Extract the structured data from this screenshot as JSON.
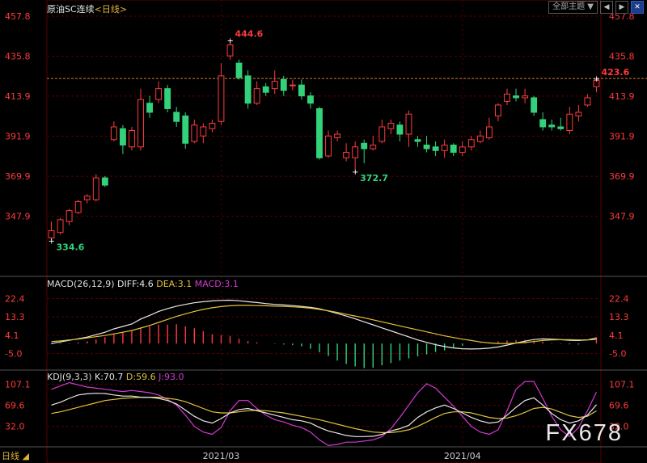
{
  "header": {
    "title": "原油SC连续",
    "period_label": "<日线>",
    "theme_select": "全部主题",
    "theme_arrow": "▼"
  },
  "toolbar": {
    "left_label": "◀",
    "right_label": "▶",
    "close_label": "✕"
  },
  "macd_header": {
    "params": "MACD(26,12,9)",
    "diff": "DIFF:4.6",
    "dea": "DEA:3.1",
    "macd": "MACD:3.1"
  },
  "kdj_header": {
    "params": "KDJ(9,3,3)",
    "k": "K:70.7",
    "d": "D:59.6",
    "j": "J:93.0"
  },
  "footer": {
    "period_button": "日线",
    "period_arrow": "◢"
  },
  "watermark": "FX678",
  "colors": {
    "up": "#ff3b3b",
    "down": "#33d27a",
    "grid": "#5a0000",
    "diff": "#e8e8e8",
    "dea": "#e0c33a",
    "j_line": "#d23ad2",
    "last_price_line": "#d27a3a"
  },
  "chart_data": [
    {
      "type": "candlestick",
      "title": "原油SC连续",
      "y_ticks": [
        "457.8",
        "435.8",
        "413.9",
        "391.9",
        "369.9",
        "347.9"
      ],
      "ylim": [
        326.0,
        457.8
      ],
      "x_ticks": [
        "2021/03",
        "2021/04"
      ],
      "last_price": 423.6,
      "annotations": [
        {
          "label": "444.6",
          "kind": "high"
        },
        {
          "label": "372.7",
          "kind": "low"
        },
        {
          "label": "334.6",
          "kind": "low"
        },
        {
          "label": "423.6",
          "kind": "last"
        }
      ],
      "candles": [
        [
          336,
          340,
          345,
          334.6
        ],
        [
          339,
          346,
          347,
          338
        ],
        [
          345,
          351,
          352,
          343
        ],
        [
          350,
          356,
          357,
          349
        ],
        [
          357,
          359,
          360,
          355
        ],
        [
          357,
          369,
          371,
          356
        ],
        [
          369,
          365,
          370,
          364
        ],
        [
          390,
          397,
          400,
          389
        ],
        [
          396,
          387,
          398,
          382
        ],
        [
          386,
          395,
          397,
          384
        ],
        [
          386,
          412,
          418,
          384
        ],
        [
          410,
          405,
          414,
          402
        ],
        [
          412,
          418,
          422,
          410
        ],
        [
          418,
          407,
          420,
          405
        ],
        [
          405,
          400,
          408,
          397
        ],
        [
          403,
          388,
          405,
          385
        ],
        [
          389,
          398,
          401,
          388
        ],
        [
          392,
          397,
          399,
          388
        ],
        [
          396,
          399,
          401,
          394
        ],
        [
          400,
          425,
          432,
          398
        ],
        [
          436,
          442,
          444.6,
          434
        ],
        [
          432,
          424,
          434,
          423
        ],
        [
          425,
          410,
          428,
          407
        ],
        [
          410,
          418,
          422,
          409
        ],
        [
          419,
          416,
          421,
          414
        ],
        [
          418,
          422,
          428,
          415
        ],
        [
          423,
          417,
          425,
          414
        ],
        [
          420,
          420,
          423,
          417
        ],
        [
          420,
          414,
          423,
          412
        ],
        [
          414,
          410,
          416,
          407
        ],
        [
          407,
          380,
          408,
          379
        ],
        [
          381,
          392,
          395,
          380
        ],
        [
          391,
          393,
          395,
          389
        ],
        [
          380,
          383,
          388,
          378
        ],
        [
          380,
          386,
          389,
          373
        ],
        [
          388,
          385,
          390,
          377
        ],
        [
          385,
          387,
          392,
          384
        ],
        [
          389,
          397,
          401,
          388
        ],
        [
          396,
          399,
          401,
          393
        ],
        [
          398,
          393,
          400,
          389
        ],
        [
          393,
          404,
          406,
          386
        ],
        [
          390,
          389,
          392,
          386
        ],
        [
          387,
          385,
          392,
          383
        ],
        [
          386,
          384,
          389,
          381
        ],
        [
          384,
          387,
          390,
          380
        ],
        [
          387,
          383,
          388,
          381
        ],
        [
          383,
          386,
          389,
          381
        ],
        [
          386,
          390,
          392,
          384
        ],
        [
          389,
          392,
          395,
          388
        ],
        [
          391,
          397,
          402,
          390
        ],
        [
          403,
          409,
          410,
          400
        ],
        [
          411,
          415,
          418,
          409
        ],
        [
          414,
          413,
          418,
          411
        ],
        [
          413,
          414,
          418,
          410
        ],
        [
          413,
          405,
          414,
          403
        ],
        [
          401,
          397,
          405,
          395
        ],
        [
          398,
          397,
          401,
          395
        ],
        [
          397,
          396,
          402,
          395
        ],
        [
          395,
          404,
          408,
          393
        ],
        [
          403,
          405,
          409,
          400
        ],
        [
          409,
          413,
          415,
          408
        ],
        [
          419,
          422.5,
          425,
          416
        ]
      ]
    },
    {
      "type": "macd",
      "params": "MACD(26,12,9)",
      "y_ticks": [
        "22.4",
        "13.3",
        "4.1",
        "-5.0"
      ],
      "ylim": [
        -10.0,
        25.0
      ],
      "diff": [
        0,
        0.8,
        1.6,
        2.4,
        3.2,
        4.4,
        5.6,
        7.3,
        8.5,
        9.7,
        12.2,
        14.0,
        16.0,
        17.4,
        18.6,
        19.5,
        20.3,
        20.8,
        21.2,
        21.5,
        21.6,
        21.3,
        20.8,
        20.4,
        19.9,
        19.5,
        19.2,
        18.9,
        18.5,
        18.0,
        17.3,
        16.2,
        15.0,
        13.7,
        12.3,
        10.8,
        9.3,
        7.8,
        6.3,
        4.8,
        3.3,
        1.8,
        0.6,
        -0.6,
        -1.5,
        -2.2,
        -2.6,
        -2.7,
        -2.6,
        -2.3,
        -1.7,
        -0.8,
        0.2,
        1.2,
        2.0,
        2.3,
        2.2,
        1.9,
        1.6,
        1.5,
        1.8,
        2.8
      ],
      "dea": [
        1.0,
        1.3,
        1.8,
        2.2,
        2.8,
        3.4,
        4.0,
        4.8,
        5.6,
        6.5,
        7.7,
        9.0,
        10.5,
        12.0,
        13.5,
        14.8,
        16.0,
        17.0,
        17.8,
        18.4,
        18.8,
        19.0,
        19.0,
        18.9,
        18.8,
        18.6,
        18.5,
        18.3,
        18.0,
        17.6,
        17.0,
        16.3,
        15.5,
        14.6,
        13.7,
        12.8,
        11.8,
        10.8,
        9.8,
        8.8,
        7.8,
        6.8,
        5.8,
        4.8,
        3.8,
        3.0,
        2.2,
        1.5,
        0.8,
        0.3,
        0.0,
        0.0,
        0.2,
        0.5,
        1.0,
        1.5,
        1.8,
        1.9,
        1.9,
        1.8,
        1.8,
        2.0
      ],
      "macd": [
        -0.3,
        -0.3,
        -0.2,
        0.6,
        1.1,
        2.0,
        3.2,
        5.0,
        5.8,
        6.4,
        8.0,
        8.6,
        9.4,
        9.4,
        9.6,
        8.6,
        7.6,
        6.2,
        4.6,
        4.2,
        3.8,
        2.4,
        1.2,
        0.6,
        0.0,
        -0.2,
        -0.5,
        -0.8,
        -1.4,
        -2.6,
        -4.3,
        -6.2,
        -8.5,
        -10.2,
        -11.4,
        -12.2,
        -12.0,
        -10.8,
        -9.7,
        -8.5,
        -7.4,
        -6.4,
        -5.4,
        -4.2,
        -3.4,
        -2.2,
        -1.1,
        -0.1,
        0.3,
        0.6,
        1.1,
        1.5,
        1.7,
        1.8,
        1.5,
        0.9,
        0.3,
        -0.2,
        -0.4,
        -0.5,
        0.0,
        3.1
      ]
    },
    {
      "type": "kdj",
      "params": "KDJ(9,3,3)",
      "y_ticks": [
        "107.1",
        "69.6",
        "32.0"
      ],
      "ylim": [
        0,
        115.0
      ],
      "k": [
        70.0,
        75.0,
        82.0,
        88.0,
        90.0,
        91.0,
        90.5,
        88.0,
        86.0,
        86.0,
        84.0,
        84.0,
        82.0,
        78.0,
        72.0,
        61.0,
        50.0,
        42.0,
        38.0,
        46.0,
        56.0,
        62.0,
        64.0,
        60.0,
        56.0,
        52.0,
        48.0,
        44.0,
        42.0,
        38.0,
        30.0,
        24.0,
        20.0,
        16.0,
        14.0,
        14.0,
        14.5,
        18.0,
        24.0,
        28.0,
        34.0,
        48.0,
        58.0,
        65.0,
        70.0,
        64.0,
        56.0,
        48.0,
        42.0,
        38.0,
        40.0,
        52.0,
        66.0,
        78.0,
        83.0,
        70.0,
        55.0,
        44.0,
        38.0,
        42.0,
        52.0,
        70.7
      ],
      "d": [
        55.0,
        58.0,
        62.0,
        66.0,
        70.0,
        74.0,
        78.0,
        80.0,
        82.0,
        83.0,
        84.0,
        84.0,
        84.0,
        82.0,
        80.0,
        76.0,
        70.0,
        64.0,
        58.0,
        56.0,
        56.0,
        58.0,
        60.0,
        61.0,
        60.0,
        58.0,
        56.0,
        53.0,
        50.0,
        47.0,
        44.0,
        40.0,
        36.0,
        32.0,
        28.0,
        25.0,
        22.0,
        21.0,
        21.0,
        23.0,
        26.0,
        32.0,
        40.0,
        48.0,
        55.0,
        58.0,
        58.0,
        56.0,
        52.0,
        48.0,
        46.0,
        47.0,
        51.0,
        57.0,
        64.0,
        66.0,
        63.0,
        57.0,
        51.0,
        48.0,
        50.0,
        59.6
      ],
      "j": [
        98.0,
        104.0,
        110.0,
        106.0,
        102.0,
        100.0,
        98.0,
        96.0,
        94.0,
        96.0,
        94.0,
        92.0,
        88.0,
        80.0,
        70.0,
        52.0,
        32.0,
        22.0,
        18.0,
        30.0,
        60.0,
        78.0,
        78.0,
        64.0,
        52.0,
        44.0,
        40.0,
        34.0,
        30.0,
        22.0,
        8.0,
        -2.0,
        0.0,
        4.0,
        4.0,
        6.0,
        8.0,
        14.0,
        28.0,
        48.0,
        70.0,
        92.0,
        108.0,
        100.0,
        84.0,
        68.0,
        50.0,
        32.0,
        22.0,
        18.0,
        26.0,
        60.0,
        98.0,
        112.0,
        112.0,
        82.0,
        50.0,
        26.0,
        14.0,
        30.0,
        60.0,
        93.0
      ]
    }
  ]
}
